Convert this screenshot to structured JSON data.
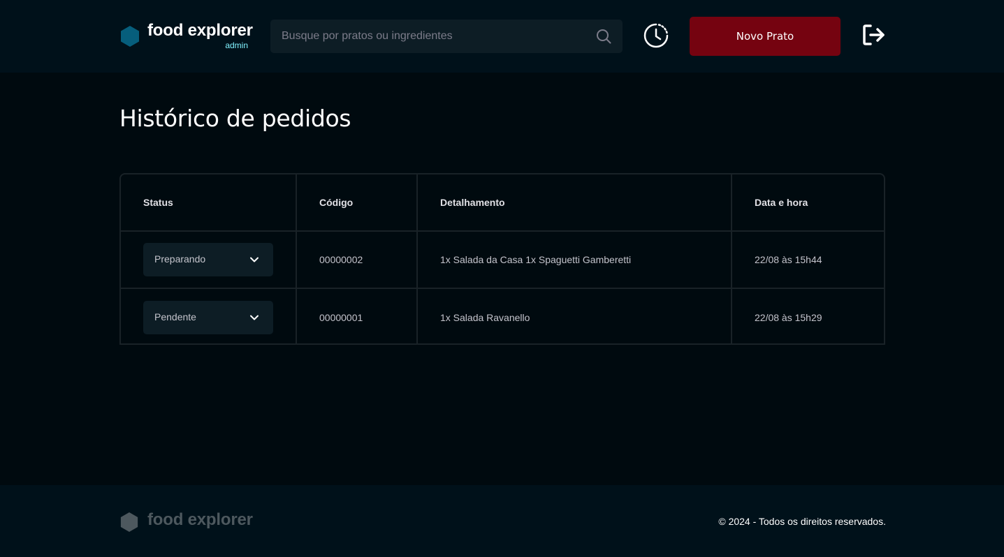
{
  "header": {
    "brand_name": "food explorer",
    "brand_role": "admin",
    "search_placeholder": "Busque por pratos ou ingredientes",
    "new_dish_label": "Novo Prato",
    "icons": {
      "logo": "hexagon-logo-icon",
      "search": "search-icon",
      "history": "clock-history-icon",
      "logout": "sign-out-icon"
    }
  },
  "main": {
    "title": "Histórico de pedidos",
    "table": {
      "columns": [
        "Status",
        "Código",
        "Detalhamento",
        "Data e hora"
      ],
      "rows": [
        {
          "status": "Preparando",
          "code": "00000002",
          "details": "1x Salada da Casa 1x Spaguetti Gamberetti",
          "datetime": "22/08 às 15h44"
        },
        {
          "status": "Pendente",
          "code": "00000001",
          "details": "1x Salada Ravanello",
          "datetime": "22/08 às 15h29"
        }
      ]
    }
  },
  "footer": {
    "brand_name": "food explorer",
    "copyright": "© 2024 - Todos os direitos reservados."
  },
  "colors": {
    "background": "#000a0f",
    "header_bg": "#00111a",
    "accent_cyan": "#82f3ff",
    "logo_blue": "#065e7c",
    "button_red": "#750310",
    "footer_logo": "#4d585e"
  }
}
